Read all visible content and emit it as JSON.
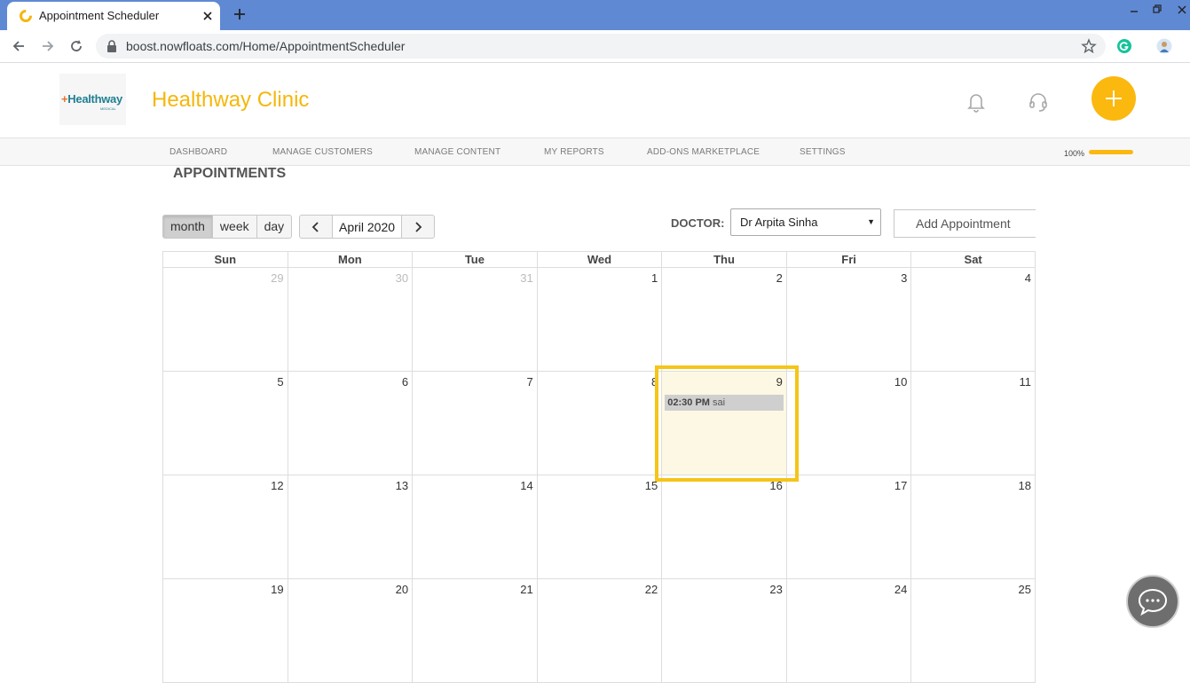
{
  "browser": {
    "tab_title": "Appointment Scheduler",
    "url": "boost.nowfloats.com/Home/AppointmentScheduler"
  },
  "header": {
    "logo_text_plus": "+",
    "logo_text": "Healthway",
    "logo_sub": "MEDICAL",
    "clinic_name": "Healthway Clinic"
  },
  "nav": {
    "items": [
      "DASHBOARD",
      "MANAGE CUSTOMERS",
      "MANAGE CONTENT",
      "MY REPORTS",
      "ADD-ONS MARKETPLACE",
      "SETTINGS"
    ],
    "progress_label": "100%",
    "progress_value": 1.0
  },
  "page": {
    "title": "APPOINTMENTS",
    "views": [
      "month",
      "week",
      "day"
    ],
    "active_view": "month",
    "month_label": "April 2020",
    "doctor_label": "DOCTOR:",
    "doctor_selected": "Dr Arpita Sinha",
    "add_appointment": "Add Appointment"
  },
  "calendar": {
    "weekdays": [
      "Sun",
      "Mon",
      "Tue",
      "Wed",
      "Thu",
      "Fri",
      "Sat"
    ],
    "weeks": [
      [
        "29",
        "30",
        "31",
        "1",
        "2",
        "3",
        "4"
      ],
      [
        "5",
        "6",
        "7",
        "8",
        "9",
        "10",
        "11"
      ],
      [
        "12",
        "13",
        "14",
        "15",
        "16",
        "17",
        "18"
      ],
      [
        "19",
        "20",
        "21",
        "22",
        "23",
        "24",
        "25"
      ]
    ],
    "today": "9",
    "event": {
      "day": "9",
      "time": "02:30 PM",
      "title": "sai"
    }
  },
  "colors": {
    "accent": "#fbb80f",
    "browser_bar": "#5f89d3",
    "today_bg": "#fcf8e3",
    "highlight": "#f5c518"
  }
}
